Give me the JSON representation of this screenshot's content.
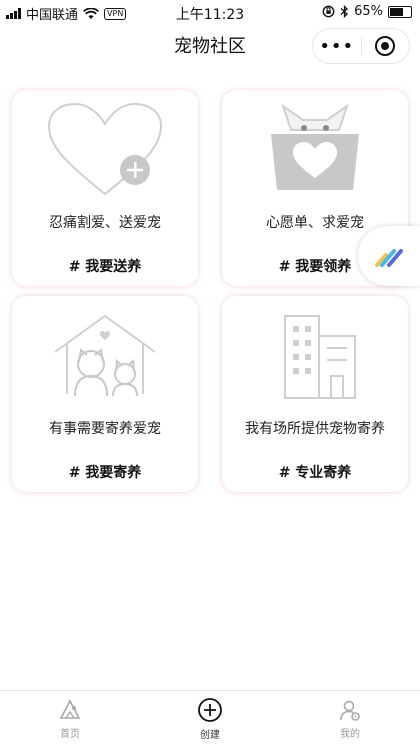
{
  "status": {
    "carrier": "中国联通",
    "vpn": "VPN",
    "time": "上午11:23",
    "battery": "65%"
  },
  "nav": {
    "title": "宠物社区",
    "more": "•••"
  },
  "cards": [
    {
      "desc": "忍痛割爱、送爱宠",
      "tag": "# 我要送养",
      "icon": "heart-plus-icon"
    },
    {
      "desc": "心愿单、求爱宠",
      "tag": "# 我要领养",
      "icon": "cat-box-icon"
    },
    {
      "desc": "有事需要寄养爱宠",
      "tag": "# 我要寄养",
      "icon": "pet-house-icon"
    },
    {
      "desc": "我有场所提供宠物寄养",
      "tag": "# 专业寄养",
      "icon": "building-icon"
    }
  ],
  "tabs": [
    {
      "label": "首页",
      "icon": "home-icon"
    },
    {
      "label": "创建",
      "icon": "add-circle-icon"
    },
    {
      "label": "我的",
      "icon": "profile-icon"
    }
  ]
}
